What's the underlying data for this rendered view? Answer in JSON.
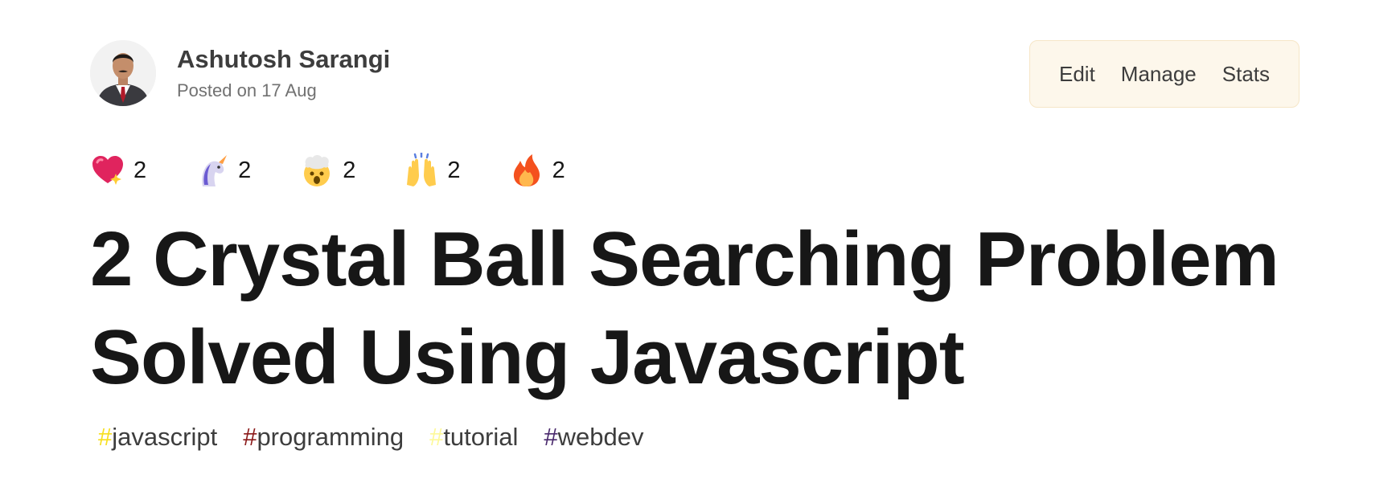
{
  "author": {
    "name": "Ashutosh Sarangi",
    "posted": "Posted on 17 Aug"
  },
  "actions": [
    "Edit",
    "Manage",
    "Stats"
  ],
  "reactions": [
    {
      "icon": "sparkle-heart-icon",
      "count": "2"
    },
    {
      "icon": "unicorn-icon",
      "count": "2"
    },
    {
      "icon": "exploding-head-icon",
      "count": "2"
    },
    {
      "icon": "raised-hands-icon",
      "count": "2"
    },
    {
      "icon": "fire-icon",
      "count": "2"
    }
  ],
  "title": "2 Crystal Ball Searching Problem Solved Using Javascript",
  "tags": [
    {
      "hash": "#",
      "name": "javascript",
      "color": "#f7df1e"
    },
    {
      "hash": "#",
      "name": "programming",
      "color": "#8b1a1a"
    },
    {
      "hash": "#",
      "name": "tutorial",
      "color": "#fdf99a"
    },
    {
      "hash": "#",
      "name": "webdev",
      "color": "#4a2a6d"
    }
  ]
}
